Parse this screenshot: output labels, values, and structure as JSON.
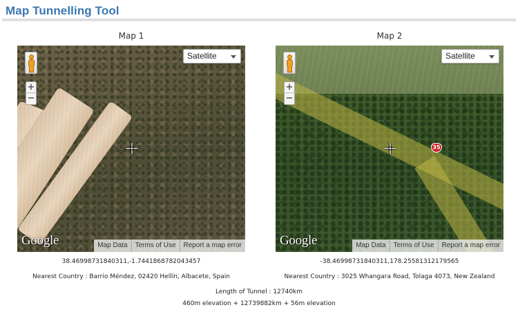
{
  "page_title": "Map Tunnelling Tool",
  "maps": [
    {
      "label": "Map 1",
      "map_type": "Satellite",
      "attribution": [
        "Map Data",
        "Terms of Use",
        "Report a map error"
      ],
      "logo": "Google",
      "coordinates": "38.46998731840311,-1.7441868782043457",
      "nearest": "Nearest Country : Barrio Méndez, 02420 Hellín, Albacete, Spain"
    },
    {
      "label": "Map 2",
      "map_type": "Satellite",
      "attribution": [
        "Map Data",
        "Terms of Use",
        "Report a map error"
      ],
      "logo": "Google",
      "road_shield": "35",
      "coordinates": "-38.46998731840311,178.25581312179565",
      "nearest": "Nearest Country : 3025 Whangara Road, Tolaga 4073, New Zealand"
    }
  ],
  "tunnel": {
    "length": "Length of Tunnel : 12740km",
    "elevation": "460m elevation + 12739882km + 56m elevation"
  },
  "colors": {
    "title": "#3a77b0",
    "pegman": "#f0a023",
    "shield": "#cc2222"
  },
  "icons": [
    "pegman-icon",
    "zoom-in-icon",
    "zoom-out-icon",
    "dropdown-caret-icon",
    "crosshair-icon"
  ]
}
